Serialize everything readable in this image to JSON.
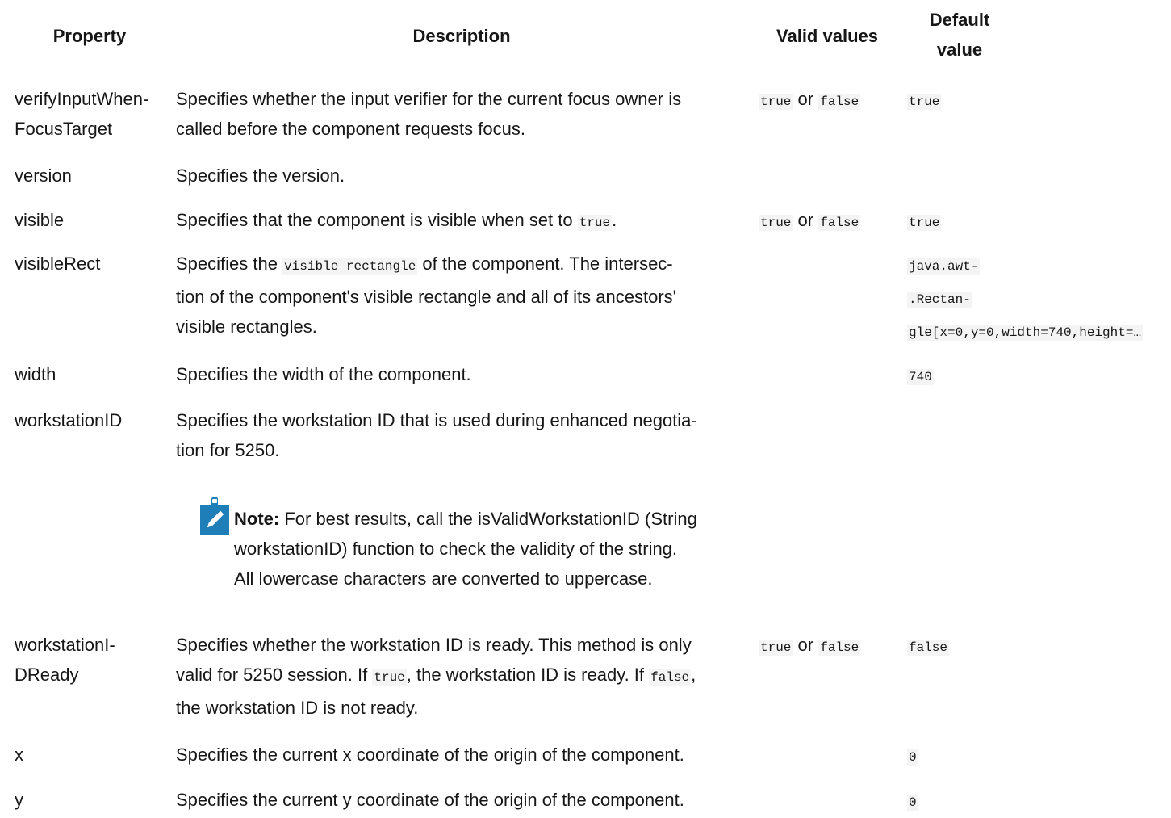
{
  "headers": {
    "property": "Property",
    "description": "Description",
    "valid": "Valid values",
    "default_line1": "Default",
    "default_line2": "value"
  },
  "or_word": "or",
  "rows": [
    {
      "property_lines": [
        "verifyInputWhen-",
        "FocusTarget"
      ],
      "description_lines": [
        "Specifies whether the input verifier for the current focus owner is",
        "called before the component requests focus."
      ],
      "valid": [
        "true",
        "false"
      ],
      "default_lines": [
        "true"
      ]
    },
    {
      "property_lines": [
        "version"
      ],
      "description_lines": [
        "Specifies the version."
      ]
    },
    {
      "property_lines": [
        "visible"
      ],
      "description_pre": "Specifies that the component is visible when set to ",
      "description_code": "true",
      "description_post": ".",
      "valid": [
        "true",
        "false"
      ],
      "default_lines": [
        "true"
      ]
    },
    {
      "property_lines": [
        "visibleRect"
      ],
      "description_pre": "Specifies the ",
      "description_code": "visible rectangle",
      "description_post": " of the component. The intersec-",
      "description_lines": [
        "tion of the component's visible rectangle and all of its ancestors'",
        "visible rectangles."
      ],
      "default_lines": [
        "java.awt-",
        ".Rectan-",
        "gle[x=0,y=0,width=740,height=…"
      ]
    },
    {
      "property_lines": [
        "width"
      ],
      "description_lines": [
        "Specifies the width of the component."
      ],
      "default_lines": [
        "740"
      ]
    },
    {
      "property_lines": [
        "workstationID"
      ],
      "description_lines": [
        "Specifies the workstation ID that is used during enhanced negotia-",
        "tion for 5250."
      ],
      "note": {
        "label": "Note:",
        "line1": " For best results, call the isValidWorkstationID (String",
        "line2": "workstationID) function to check the validity of the string.",
        "line3": "All lowercase characters are converted to uppercase.",
        "icon": "pencil-note-icon",
        "icon_color": "#1e7fb8"
      }
    },
    {
      "property_lines": [
        "workstationI-",
        "DReady"
      ],
      "description_line1": "Specifies whether the workstation ID is ready. This method is only",
      "description_line2_pre": "valid for 5250 session. If ",
      "description_line2_code1": "true",
      "description_line2_mid": ", the workstation ID is ready. If ",
      "description_line2_code2": "false",
      "description_line2_post": ",",
      "description_line3": "the workstation ID is not ready.",
      "valid": [
        "true",
        "false"
      ],
      "default_lines": [
        "false"
      ]
    },
    {
      "property_lines": [
        "x"
      ],
      "description_lines": [
        "Specifies the current x coordinate of the origin of the component."
      ],
      "default_lines": [
        "0"
      ]
    },
    {
      "property_lines": [
        "y"
      ],
      "description_lines": [
        "Specifies the current y coordinate of the origin of the component."
      ],
      "default_lines": [
        "0"
      ]
    }
  ]
}
